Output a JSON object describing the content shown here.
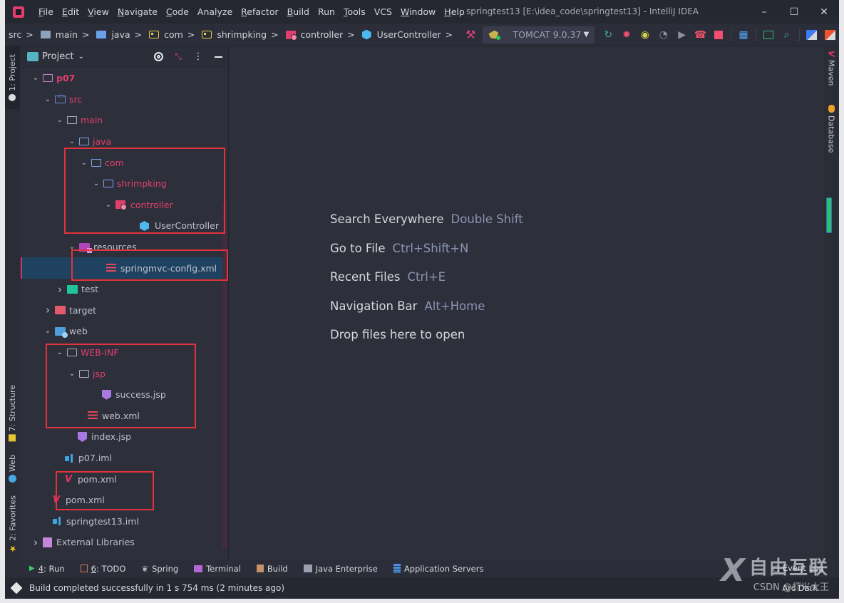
{
  "titlebar": {
    "menu": [
      {
        "label": "File",
        "mnemonic": "F",
        "rest": "ile"
      },
      {
        "label": "Edit",
        "mnemonic": "E",
        "rest": "dit"
      },
      {
        "label": "View",
        "mnemonic": "V",
        "rest": "iew"
      },
      {
        "label": "Navigate",
        "mnemonic": "N",
        "rest": "avigate"
      },
      {
        "label": "Code",
        "mnemonic": "C",
        "rest": "ode"
      },
      {
        "label": "Analyze",
        "mnemonic": "",
        "rest": "Analyze"
      },
      {
        "label": "Refactor",
        "mnemonic": "R",
        "rest": "efactor"
      },
      {
        "label": "Build",
        "mnemonic": "B",
        "rest": "uild"
      },
      {
        "label": "Run",
        "mnemonic": "",
        "rest": "Run"
      },
      {
        "label": "Tools",
        "mnemonic": "T",
        "rest": "ools"
      },
      {
        "label": "VCS",
        "mnemonic": "",
        "rest": "VCS"
      },
      {
        "label": "Window",
        "mnemonic": "W",
        "rest": "indow"
      },
      {
        "label": "Help",
        "mnemonic": "H",
        "rest": "elp"
      }
    ],
    "window_title": "springtest13 [E:\\idea_code\\springtest13] - IntelliJ IDEA",
    "minimize": "–",
    "maximize": "☐",
    "close": "✕"
  },
  "navbar": {
    "breadcrumbs": [
      "src",
      "main",
      "java",
      "com",
      "shrimpking",
      "controller",
      "UserController"
    ],
    "separator": ">",
    "run_config": "TOMCAT 9.0.37",
    "toolbar_icons": [
      "update-icon",
      "debug-icon",
      "coverage-icon",
      "profile-icon",
      "run-icon",
      "attach-icon",
      "stop-icon",
      "structure-grid-icon",
      "terminal-icon",
      "search-icon",
      "translate-icon",
      "translate-alt-icon"
    ]
  },
  "left_strip": {
    "project": "1: Project",
    "structure": "7: Structure",
    "web": "Web",
    "favorites": "2: Favorites"
  },
  "project_panel": {
    "title": "Project",
    "tree": [
      {
        "label": "p07",
        "level": 0,
        "expanded": true,
        "icon": "module-folder",
        "style": "red-bold"
      },
      {
        "label": "src",
        "level": 1,
        "expanded": true,
        "icon": "source-folder",
        "style": "red"
      },
      {
        "label": "main",
        "level": 2,
        "expanded": true,
        "icon": "folder",
        "style": "red"
      },
      {
        "label": "java",
        "level": 3,
        "expanded": true,
        "icon": "folder-blue",
        "style": "red"
      },
      {
        "label": "com",
        "level": 4,
        "expanded": true,
        "icon": "folder-blue",
        "style": "red"
      },
      {
        "label": "shrimpking",
        "level": 5,
        "expanded": true,
        "icon": "folder-blue",
        "style": "red"
      },
      {
        "label": "controller",
        "level": 6,
        "expanded": true,
        "icon": "controller-folder",
        "style": "red"
      },
      {
        "label": "UserController",
        "level": 7,
        "expanded": null,
        "icon": "class",
        "style": "normal"
      },
      {
        "label": "resources",
        "level": 3,
        "expanded": true,
        "icon": "resources-folder",
        "style": "normal"
      },
      {
        "label": "springmvc-config.xml",
        "level": 4,
        "expanded": null,
        "icon": "xml",
        "style": "normal",
        "selected": true
      },
      {
        "label": "test",
        "level": 2,
        "expanded": false,
        "icon": "test-folder",
        "style": "normal"
      },
      {
        "label": "target",
        "level": 1,
        "expanded": false,
        "icon": "target-folder",
        "style": "normal"
      },
      {
        "label": "web",
        "level": 1,
        "expanded": true,
        "icon": "web-folder",
        "style": "normal"
      },
      {
        "label": "WEB-INF",
        "level": 2,
        "expanded": true,
        "icon": "folder",
        "style": "red"
      },
      {
        "label": "jsp",
        "level": 3,
        "expanded": true,
        "icon": "folder",
        "style": "red"
      },
      {
        "label": "success.jsp",
        "level": 5,
        "expanded": null,
        "icon": "jsp",
        "style": "normal"
      },
      {
        "label": "web.xml",
        "level": 3,
        "expanded": null,
        "icon": "xml",
        "style": "normal"
      },
      {
        "label": "index.jsp",
        "level": 3,
        "expanded": null,
        "icon": "jsp",
        "style": "normal"
      },
      {
        "label": "p07.iml",
        "level": 2,
        "expanded": null,
        "icon": "iml",
        "style": "normal"
      },
      {
        "label": "pom.xml",
        "level": 2,
        "expanded": null,
        "icon": "maven",
        "style": "normal"
      },
      {
        "label": "pom.xml",
        "level": 1,
        "expanded": null,
        "icon": "maven",
        "style": "normal"
      },
      {
        "label": "springtest13.iml",
        "level": 1,
        "expanded": null,
        "icon": "iml",
        "style": "normal"
      },
      {
        "label": "External Libraries",
        "level": 0,
        "expanded": false,
        "icon": "libraries",
        "style": "normal"
      }
    ]
  },
  "editor": {
    "hints": [
      {
        "action": "Search Everywhere",
        "shortcut": "Double Shift"
      },
      {
        "action": "Go to File",
        "shortcut": "Ctrl+Shift+N"
      },
      {
        "action": "Recent Files",
        "shortcut": "Ctrl+E"
      },
      {
        "action": "Navigation Bar",
        "shortcut": "Alt+Home"
      },
      {
        "action": "Drop files here to open",
        "shortcut": ""
      }
    ]
  },
  "right_strip": {
    "maven": "Maven",
    "database": "Database"
  },
  "bottom_bar": {
    "tabs": [
      {
        "num": "4",
        "label": ": Run",
        "icon": "run-icon"
      },
      {
        "num": "6",
        "label": ": TODO",
        "icon": "todo-icon"
      },
      {
        "num": "",
        "label": "Spring",
        "icon": "spring-icon"
      },
      {
        "num": "",
        "label": "Terminal",
        "icon": "terminal-icon"
      },
      {
        "num": "",
        "label": "Build",
        "icon": "build-icon"
      },
      {
        "num": "",
        "label": "Java Enterprise",
        "icon": "java-enterprise-icon"
      },
      {
        "num": "",
        "label": "Application Servers",
        "icon": "app-servers-icon"
      }
    ],
    "event_log": "Event Log"
  },
  "status_bar": {
    "message": "Build completed successfully in 1 s 754 ms (2 minutes ago)",
    "theme": "Arc Dark"
  },
  "watermark": {
    "brand": "自由互联",
    "credit": "CSDN @虾米大王"
  },
  "colors": {
    "accent_red": "#e03f6c",
    "annotation_box": "#e0333c",
    "selection": "#1f4261",
    "background": "#2d2f3a",
    "shortcut_text": "#8a93b3"
  }
}
